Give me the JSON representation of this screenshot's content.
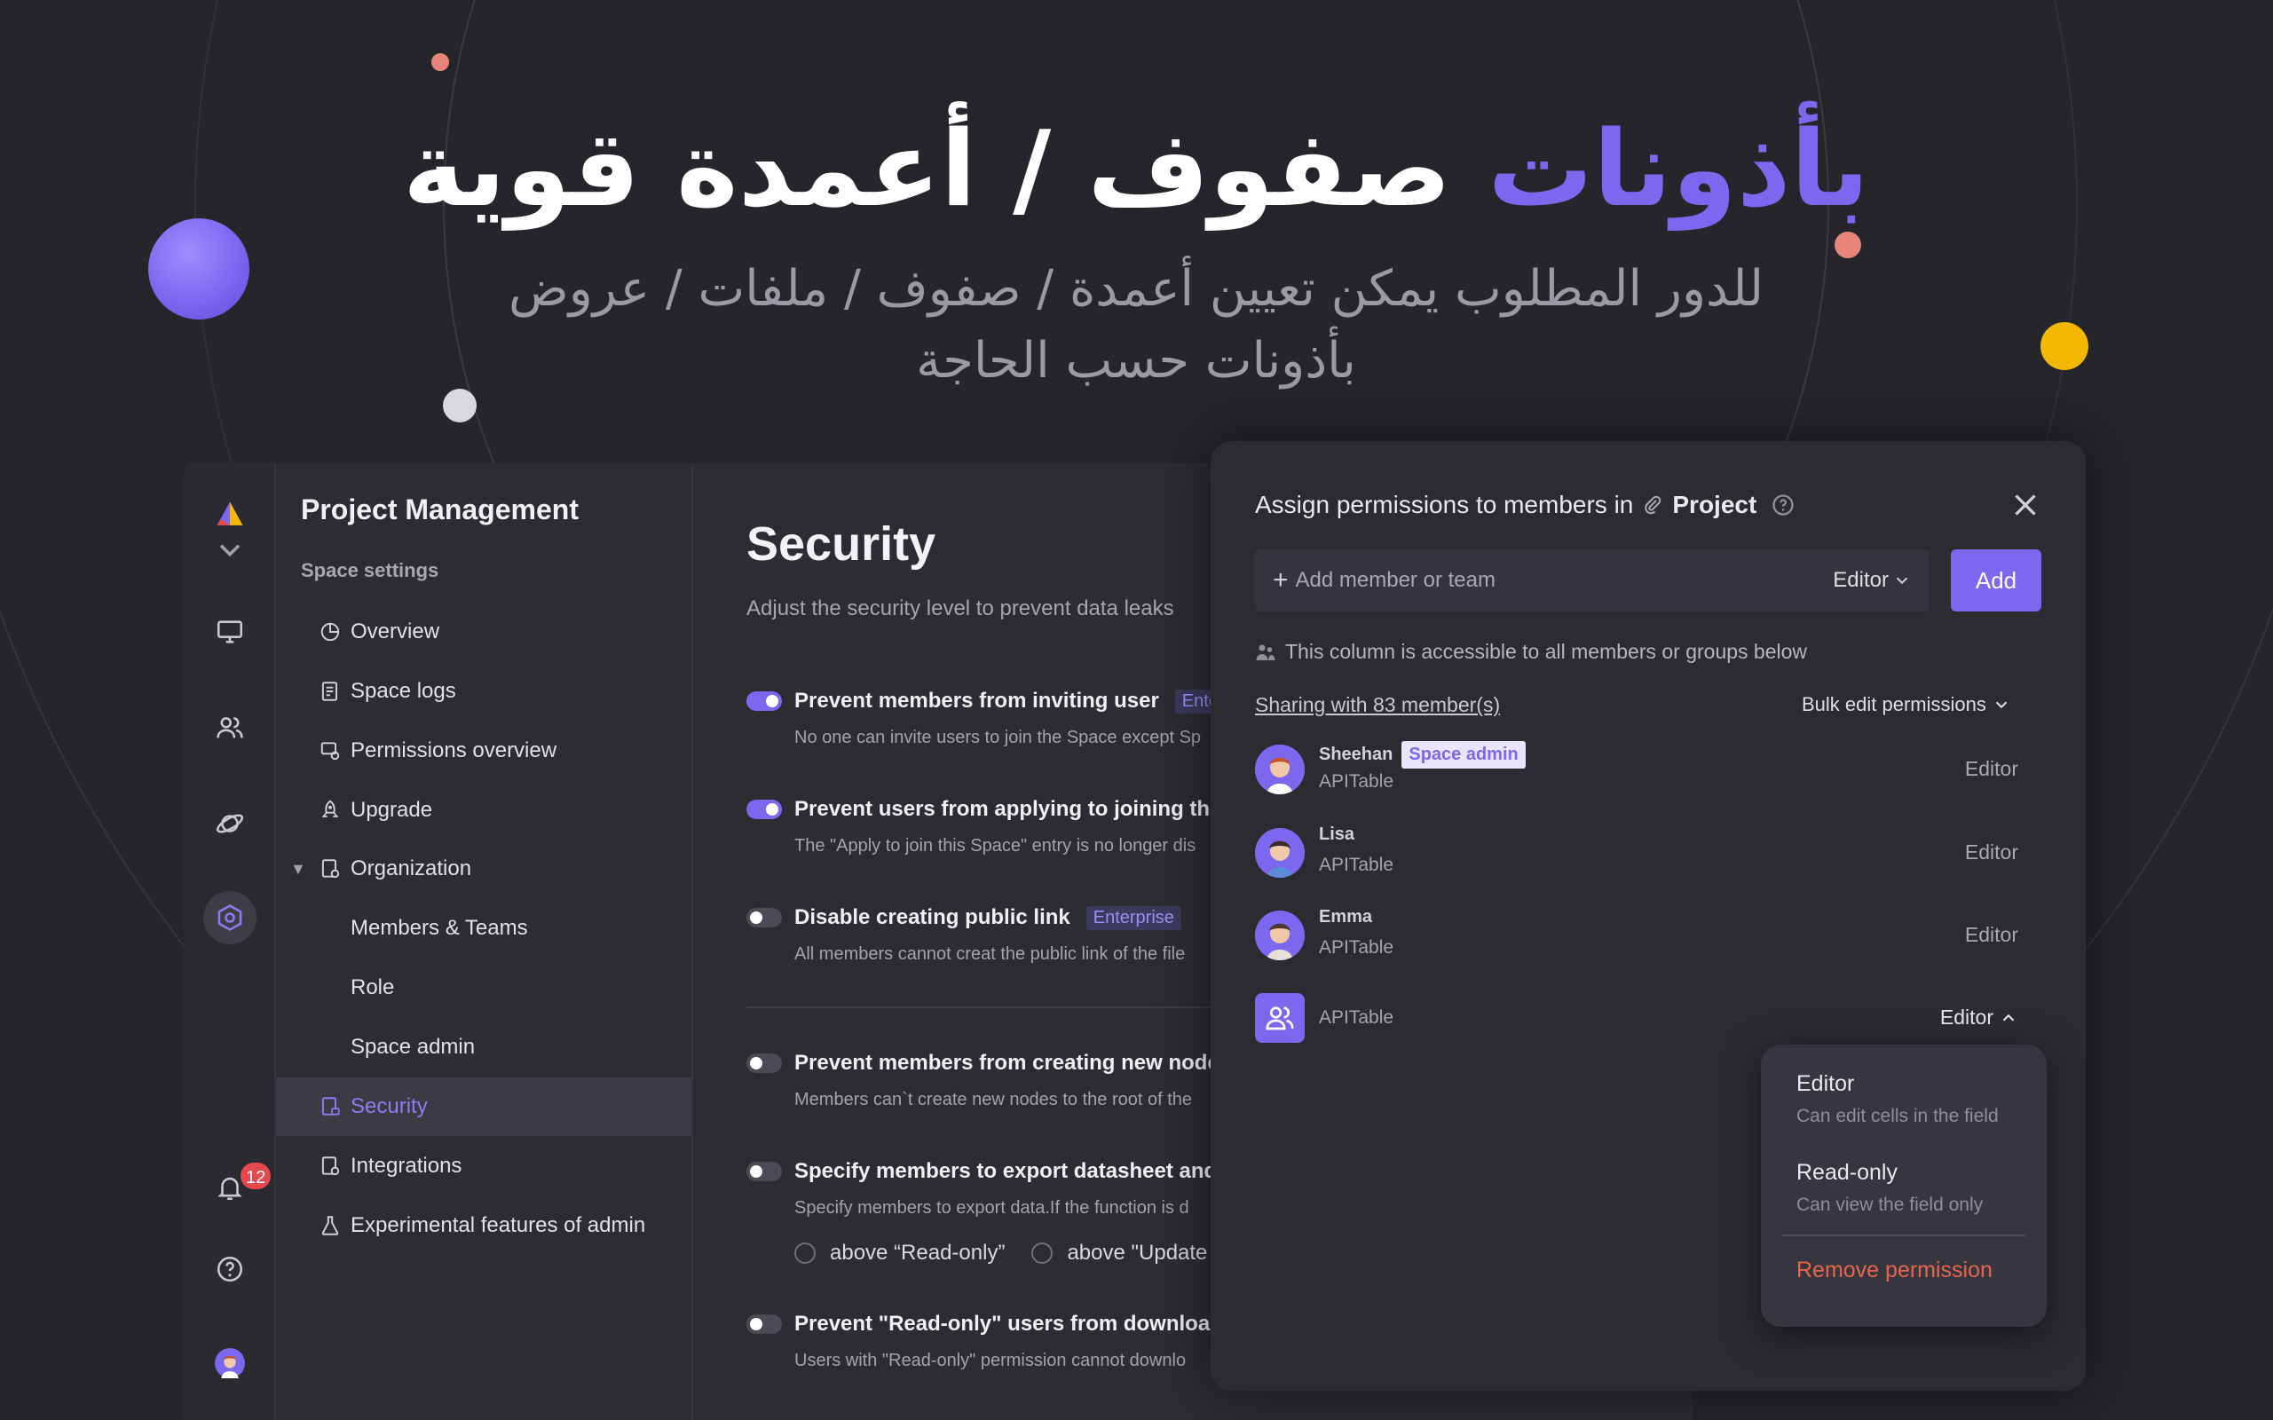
{
  "hero": {
    "title_accent": "بأذونات",
    "title_rest": "صفوف / أعمدة قوية",
    "subtitle_line1": "للدور المطلوب يمكن تعيين أعمدة / صفوف / ملفات / عروض",
    "subtitle_line2": "بأذونات حسب الحاجة"
  },
  "sidebar": {
    "title": "Project Management",
    "section": "Space settings",
    "items": [
      {
        "label": "Overview"
      },
      {
        "label": "Space logs"
      },
      {
        "label": "Permissions overview"
      },
      {
        "label": "Upgrade"
      },
      {
        "label": "Organization"
      },
      {
        "label": "Members & Teams"
      },
      {
        "label": "Role"
      },
      {
        "label": "Space admin"
      },
      {
        "label": "Security"
      },
      {
        "label": "Integrations"
      },
      {
        "label": "Experimental features of admin"
      }
    ]
  },
  "rail": {
    "notification_count": "12"
  },
  "main": {
    "title": "Security",
    "subtitle": "Adjust the security level to prevent data leaks",
    "settings": [
      {
        "label": "Prevent members from inviting user",
        "tag": "Enter",
        "desc": "No one can invite users to join the Space except Sp",
        "on": true
      },
      {
        "label": "Prevent users from applying to joining the S",
        "desc": "The \"Apply to join this Space\" entry is no longer dis",
        "on": true
      },
      {
        "label": "Disable creating public link",
        "tag": "Enterprise",
        "desc": "All members cannot creat the public link of the file",
        "on": false
      },
      {
        "label": "Prevent members from creating new nodes",
        "desc": "Members can`t create new nodes to the root of the",
        "on": false
      },
      {
        "label": "Specify members to export datasheet and v",
        "desc": "Specify members to export data.If the function is d",
        "on": false
      },
      {
        "label": "Prevent \"Read-only\" users from downloadir",
        "desc": "Users with \"Read-only\" permission cannot downlo",
        "on": false
      }
    ],
    "radio_1": "above “Read-only”",
    "radio_2": "above \"Update"
  },
  "modal": {
    "heading": "Assign permissions to members in",
    "project": "Project",
    "input_placeholder": "Add member or team",
    "input_role": "Editor",
    "add_label": "Add",
    "note": "This column is accessible to all members or groups below",
    "sharing": "Sharing with 83 member(s)",
    "bulk": "Bulk edit permissions",
    "members": [
      {
        "name": "Sheehan",
        "badge": "Space admin",
        "org": "APITable",
        "role": "Editor"
      },
      {
        "name": "Lisa",
        "org": "APITable",
        "role": "Editor"
      },
      {
        "name": "Emma",
        "org": "APITable",
        "role": "Editor"
      },
      {
        "name": "",
        "org": "APITable",
        "role": "Editor"
      }
    ],
    "dropdown": {
      "opt1_title": "Editor",
      "opt1_desc": "Can edit cells in the field",
      "opt2_title": "Read-only",
      "opt2_desc": "Can view the field only",
      "remove": "Remove permission"
    }
  },
  "colors": {
    "accent": "#7b68ee",
    "background": "#25262b",
    "danger": "#e8644f"
  }
}
